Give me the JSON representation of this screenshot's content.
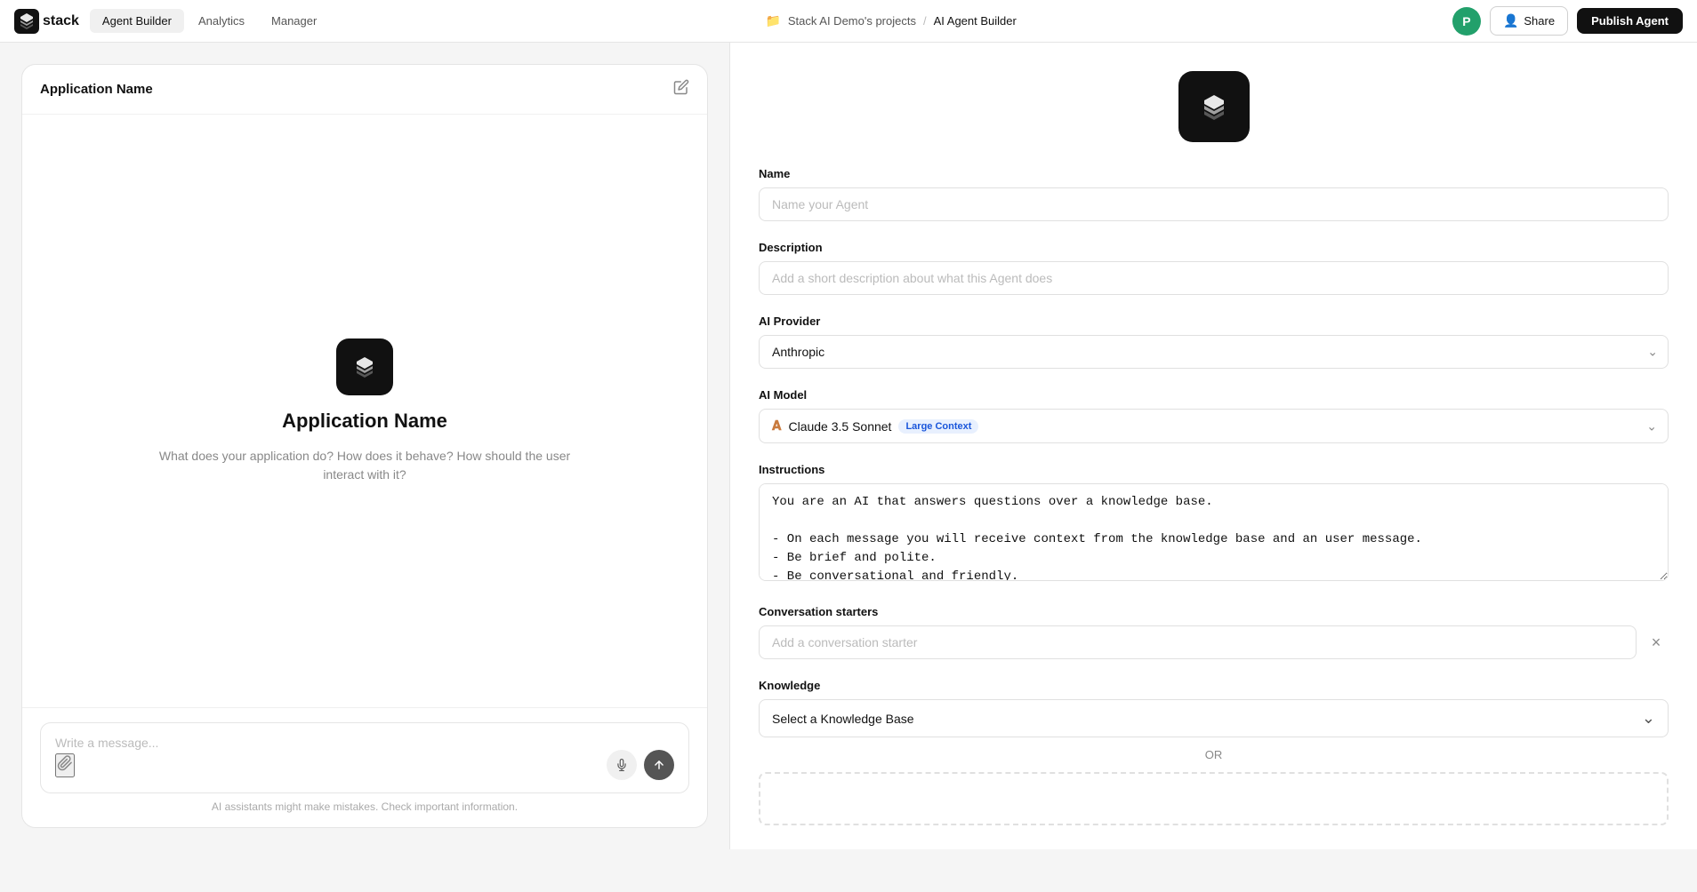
{
  "brand": {
    "logo_text": "stack",
    "logo_icon": "⬡"
  },
  "nav": {
    "tabs": [
      {
        "id": "agent-builder",
        "label": "Agent Builder",
        "active": true
      },
      {
        "id": "analytics",
        "label": "Analytics",
        "active": false
      },
      {
        "id": "manager",
        "label": "Manager",
        "active": false
      }
    ],
    "breadcrumb_project": "Stack AI Demo's projects",
    "breadcrumb_page": "AI Agent Builder",
    "avatar_initial": "P",
    "share_label": "Share",
    "publish_label": "Publish Agent"
  },
  "chat_panel": {
    "header_title": "Application Name",
    "app_icon_alt": "Stack AI logo",
    "app_name": "Application Name",
    "app_description": "What does your application do? How does it behave? How should the user interact with it?",
    "input_placeholder": "Write a message...",
    "disclaimer": "AI assistants might make mistakes. Check important information."
  },
  "settings_panel": {
    "agent_icon_alt": "Stack AI Agent Icon",
    "name_label": "Name",
    "name_placeholder": "Name your Agent",
    "description_label": "Description",
    "description_placeholder": "Add a short description about what this Agent does",
    "ai_provider_label": "AI Provider",
    "ai_provider_value": "Anthropic",
    "ai_model_label": "AI Model",
    "ai_model_value": "Claude 3.5 Sonnet",
    "ai_model_badge": "Large Context",
    "instructions_label": "Instructions",
    "instructions_value": "You are an AI that answers questions over a knowledge base.\n\n- On each message you will receive context from the knowledge base and an user message.\n- Be brief and polite.\n- Be conversational and friendly.",
    "conversation_starters_label": "Conversation starters",
    "conversation_starter_placeholder": "Add a conversation starter",
    "knowledge_label": "Knowledge",
    "knowledge_select_placeholder": "Select a Knowledge Base",
    "knowledge_or": "OR"
  }
}
